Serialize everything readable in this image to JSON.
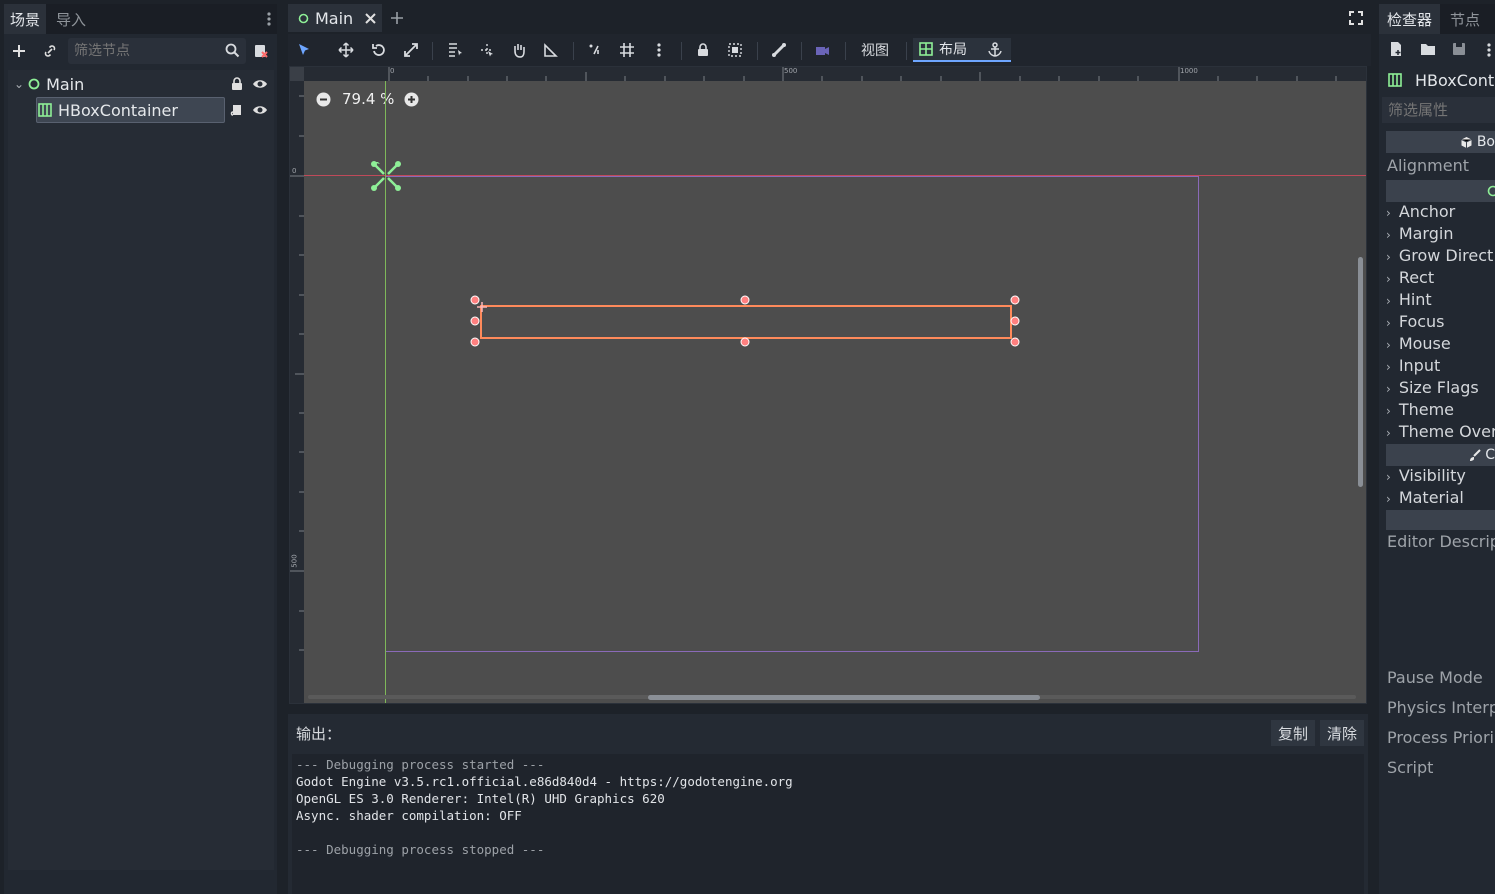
{
  "scene_dock": {
    "tabs": [
      "场景",
      "导入"
    ],
    "filter_placeholder": "筛选节点",
    "tree": [
      {
        "label": "Main"
      },
      {
        "label": "HBoxContainer"
      }
    ]
  },
  "editor": {
    "scene_tab": "Main",
    "zoom": "79.4 %",
    "toolbar": {
      "view_menu": "视图",
      "layout_menu": "布局"
    },
    "ruler_labels": {
      "top": [
        "0",
        "500",
        "1000"
      ],
      "left": [
        "0",
        "500"
      ]
    }
  },
  "output": {
    "title": "输出：",
    "copy_button": "复制",
    "clear_button": "清除",
    "lines": [
      "--- Debugging process started ---",
      "Godot Engine v3.5.rc1.official.e86d840d4 - https://godotengine.org",
      "OpenGL ES 3.0 Renderer: Intel(R) UHD Graphics 620",
      "Async. shader compilation: OFF",
      "",
      "--- Debugging process stopped ---"
    ]
  },
  "inspector": {
    "tabs": [
      "检查器",
      "节点"
    ],
    "node_name": "HBoxCont",
    "filter_placeholder": "筛选属性",
    "boxcontainer_label": "Bo",
    "alignment_label": "Alignment",
    "control_sections": [
      "Anchor",
      "Margin",
      "Grow Direct",
      "Rect",
      "Hint",
      "Focus",
      "Mouse",
      "Input",
      "Size Flags",
      "Theme",
      "Theme Over"
    ],
    "canvasitem_label": "C",
    "canvasitem_sections": [
      "Visibility",
      "Material"
    ],
    "editor_description": "Editor Descrip",
    "node_props": [
      "Pause Mode",
      "Physics Interp",
      "Process Priori",
      "Script"
    ]
  },
  "colors": {
    "accent": "#6ea6ff",
    "node_green": "#8eef97",
    "selection_orange": "#ff8a5b",
    "viewport_bg": "#4d4d4d"
  }
}
